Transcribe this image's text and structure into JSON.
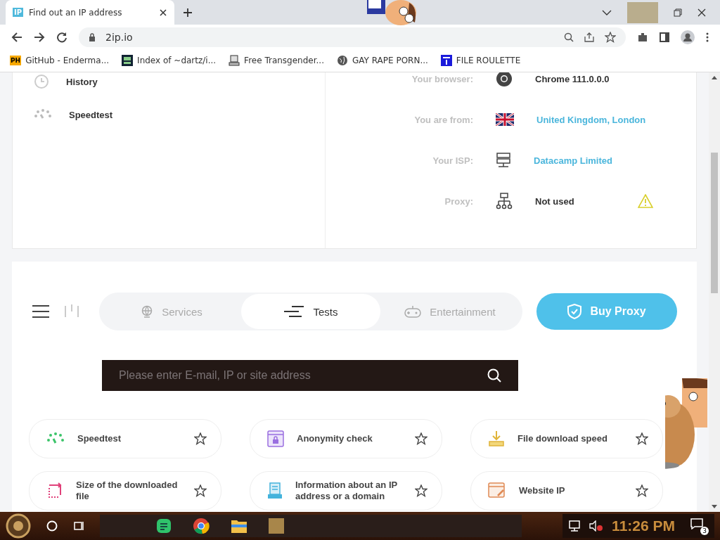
{
  "browser": {
    "tab": {
      "favicon": "IP",
      "title": "Find out an IP address"
    },
    "address": "2ip.io",
    "bookmarks": [
      {
        "kind": "badge",
        "badge": "PH",
        "label": "GitHub - Enderma..."
      },
      {
        "kind": "square",
        "label": "Index of ~dartz/i..."
      },
      {
        "kind": "computer",
        "label": "Free Transgender..."
      },
      {
        "kind": "globe",
        "label": "GAY RAPE PORN..."
      },
      {
        "kind": "blue",
        "label": "FILE ROULETTE"
      }
    ]
  },
  "sidebar": {
    "items": [
      {
        "label": "History",
        "kind": "clock"
      },
      {
        "label": "Speedtest",
        "kind": "speed"
      }
    ]
  },
  "info": [
    {
      "label": "Your browser:",
      "value": "Chrome 111.0.0.0",
      "kind": "chrome",
      "link": false,
      "warning": false
    },
    {
      "label": "You are from:",
      "value": "United Kingdom, London",
      "kind": "flag",
      "link": true,
      "warning": false
    },
    {
      "label": "Your ISP:",
      "value": "Datacamp Limited",
      "kind": "server",
      "link": true,
      "warning": false
    },
    {
      "label": "Proxy:",
      "value": "Not used",
      "kind": "network",
      "link": false,
      "warning": true
    }
  ],
  "nav": {
    "tabs": [
      {
        "label": "Services",
        "kind": "globe",
        "selected": false
      },
      {
        "label": "Tests",
        "kind": "lines",
        "selected": true
      },
      {
        "label": "Entertainment",
        "kind": "gamepad",
        "selected": false
      }
    ],
    "button": "Buy Proxy"
  },
  "search": {
    "placeholder": "Please enter E-mail, IP or site address"
  },
  "tools": [
    {
      "label": "Speedtest",
      "kind": "speed"
    },
    {
      "label": "Anonymity check",
      "kind": "lock"
    },
    {
      "label": "File download speed",
      "kind": "download"
    },
    {
      "label": "Size of the downloaded file",
      "kind": "resize"
    },
    {
      "label": "Information about an IP address or a domain",
      "kind": "doc"
    },
    {
      "label": "Website IP",
      "kind": "web"
    }
  ],
  "taskbar": {
    "time": "11:26 PM",
    "notifications": "3"
  }
}
